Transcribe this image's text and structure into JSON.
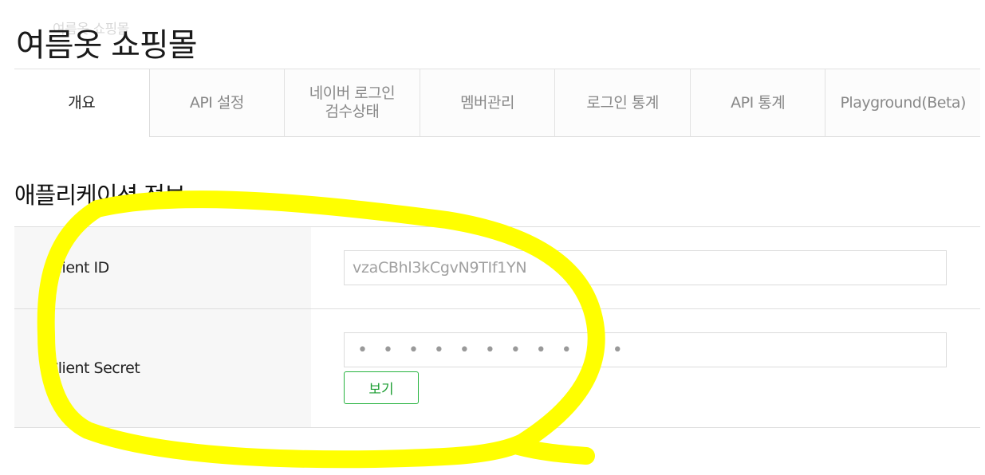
{
  "header": {
    "ghost_title": "여름옷 쇼핑몰",
    "app_title": "여름옷 쇼핑몰"
  },
  "tabs": [
    {
      "label": "개요",
      "active": true
    },
    {
      "label": "API 설정",
      "active": false
    },
    {
      "label": "네이버 로그인\n검수상태",
      "active": false
    },
    {
      "label": "멤버관리",
      "active": false
    },
    {
      "label": "로그인 통계",
      "active": false
    },
    {
      "label": "API 통계",
      "active": false
    },
    {
      "label": "Playground(Beta)",
      "active": false
    }
  ],
  "section": {
    "title": "애플리케이션 정보"
  },
  "client_id": {
    "label": "Client ID",
    "value": "vzaCBhl3kCgvN9TIf1YN"
  },
  "client_secret": {
    "label": "Client Secret",
    "masked_value": "• • • • • • • • • • •",
    "view_button_label": "보기"
  },
  "colors": {
    "accent_green": "#27b33f",
    "annotation_yellow": "#ffff00"
  }
}
